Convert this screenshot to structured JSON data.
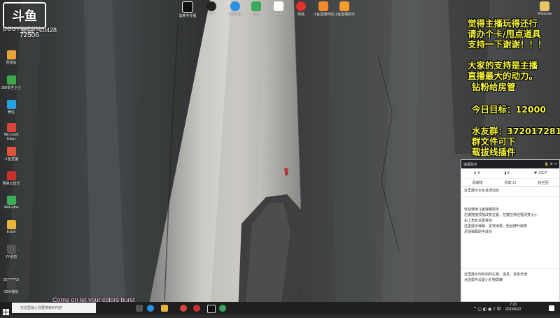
{
  "watermark": {
    "logo": "斗鱼",
    "site": "DOUYU.COM",
    "room_label": "房间",
    "room_number": "10428",
    "room_number_2": "72506"
  },
  "desktop_icons_left": [
    {
      "label": "回收站"
    },
    {
      "label": "360安全卫士"
    },
    {
      "label": "微信"
    },
    {
      "label": "Microsoft Edge"
    },
    {
      "label": "斗鱼直播"
    },
    {
      "label": "网易云音乐"
    },
    {
      "label": "WeGame"
    },
    {
      "label": "Excel"
    },
    {
      "label": "YY语音"
    },
    {
      "label": "20220312"
    },
    {
      "label": "20W播放"
    }
  ],
  "desktop_icons_top": [
    {
      "label": "剪映专业版"
    },
    {
      "label": "OBS"
    },
    {
      "label": "哔哩直播"
    },
    {
      "label": "迅雷"
    },
    {
      "label": "Steam"
    },
    {
      "label": "网易"
    },
    {
      "label": "斗鱼直播伴侣"
    },
    {
      "label": "斗鱼直播助手"
    }
  ],
  "desktop_icon_topright": {
    "label": "Windows"
  },
  "overlay": {
    "line1": "觉得主播玩得还行",
    "line2": "请办个卡/甩点道具",
    "line3": "支持一下谢谢！！！",
    "line4": "大家的支持是主播",
    "line5": "直播最大的动力。",
    "line6": "钻粉给房管",
    "goal_label": "今日目标：",
    "goal_value": "12000",
    "group_label": "水友群：",
    "group_value": "372017281",
    "line9": "群文件可下",
    "line10": "载拔线插件"
  },
  "chat_panel": {
    "title": "弹幕助手",
    "stat1": "6",
    "stat2": "8",
    "stat3": "2927",
    "tab1": "贡献榜",
    "tab2": "贵宾(1)",
    "tab3": "粉丝团",
    "msg1": "这里展示水友进场消息",
    "msg2": "欢迎使用斗鱼弹幕助手",
    "msg3": "左键拖拽顶部改变位置，左键拉伸边框改变大小",
    "msg4": "右上角有设置菜单",
    "msg5": "这里展示弹幕、贵宾续费、粉丝牌升级等",
    "msg6": "添加弹幕助手成功",
    "msg7": "这里展示你收到的礼物、道具、贵族开通",
    "msg8": "点击帮可设置小礼物屏蔽"
  },
  "bottom_text": "Come on let your colors burst",
  "taskbar": {
    "search_placeholder": "在这里输入你要搜索的内容",
    "time": "7:23",
    "date": "2022/5/22"
  },
  "colors": {
    "overlay_text": "#f7f53a",
    "taskbar": "#1f1f22"
  }
}
